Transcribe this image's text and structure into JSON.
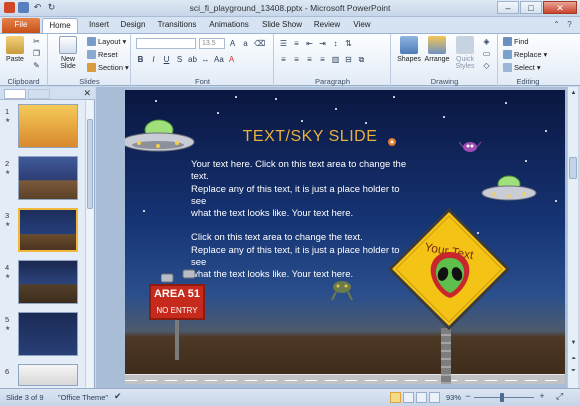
{
  "window": {
    "title": "sci_fi_playground_13408.pptx - Microsoft PowerPoint"
  },
  "tabs": [
    "File",
    "Home",
    "Insert",
    "Design",
    "Transitions",
    "Animations",
    "Slide Show",
    "Review",
    "View"
  ],
  "ribbon": {
    "clipboard": {
      "label": "Clipboard",
      "paste": "Paste"
    },
    "slides": {
      "label": "Slides",
      "new_slide": "New Slide",
      "layout": "Layout",
      "reset": "Reset",
      "section": "Section"
    },
    "font": {
      "label": "Font",
      "size_placeholder": "13.5"
    },
    "paragraph": {
      "label": "Paragraph"
    },
    "drawing": {
      "label": "Drawing",
      "shapes": "Shapes",
      "arrange": "Arrange",
      "quick_styles": "Quick Styles"
    },
    "editing": {
      "label": "Editing",
      "find": "Find",
      "replace": "Replace",
      "select": "Select"
    }
  },
  "thumbnails": [
    {
      "num": "1"
    },
    {
      "num": "2"
    },
    {
      "num": "3"
    },
    {
      "num": "4"
    },
    {
      "num": "5"
    },
    {
      "num": "6"
    }
  ],
  "slide": {
    "title": "TEXT/SKY SLIDE",
    "body_1": [
      "Your text here. Click on this text area to change the",
      "text.",
      "Replace any of this text, it is just a place holder to",
      "see",
      "what the text looks like. Your text here."
    ],
    "body_2": [
      "Click on this text area to change the text.",
      "Replace any of this text, it is just a place holder to",
      "see",
      "what the text looks like. Your text here."
    ],
    "sign_line1": "AREA 51",
    "sign_line2": "NO ENTRY",
    "warning_text": "Your Text"
  },
  "status": {
    "slide_of": "Slide 3 of 9",
    "theme": "\"Office Theme\"",
    "zoom": "93%"
  },
  "colors": {
    "file_tab": "#c85018",
    "title_gold": "#e9b13a",
    "sign_red": "#c62a1c",
    "warning_yellow": "#f3c316"
  }
}
